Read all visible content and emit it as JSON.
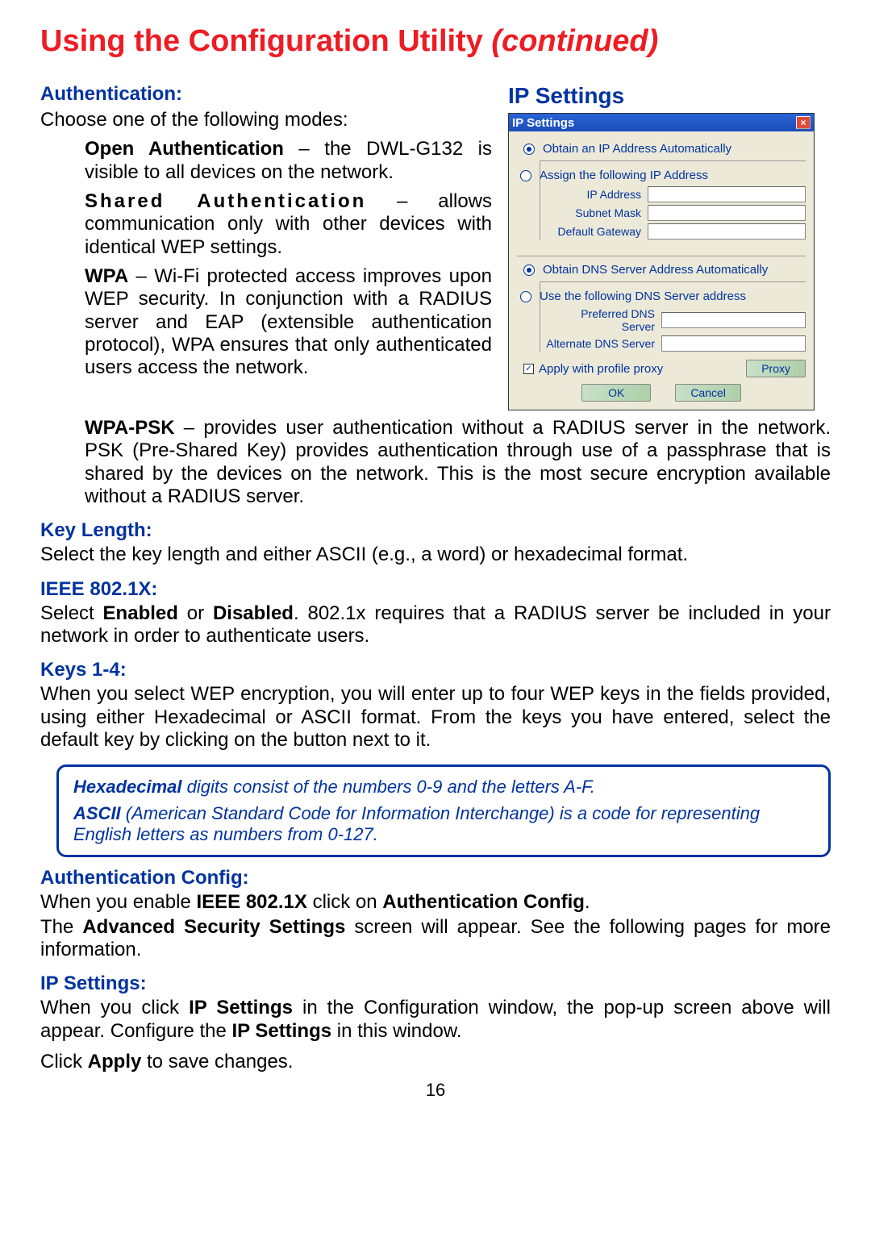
{
  "title_main": "Using the Configuration Utility ",
  "title_cont": "(continued)",
  "auth_header": "Authentication:",
  "auth_intro": "Choose one of the following modes:",
  "open_auth_b": "Open Authentication",
  "open_auth_txt": " – the DWL-G132 is visible to all devices on the network.",
  "shared_b": "Shared Authentication",
  "shared_txt": " – allows communication only with other devices with identical WEP settings.",
  "wpa_b": "WPA",
  "wpa_txt": " – Wi-Fi protected access improves upon WEP security. In conjunction with a RADIUS server and EAP (extensible authentication protocol), WPA ensures that only authenticated users access the network.",
  "wpapsk_b": "WPA-PSK",
  "wpapsk_txt": " –  provides user authentication without a RADIUS server in the network. PSK (Pre-Shared Key) provides authentication through use of a  passphrase that is shared by the devices on the network. This is the most secure encryption available without a RADIUS server.",
  "keylen_h": "Key Length:",
  "keylen_txt": "Select the key length and either ASCII (e.g., a word) or hexadecimal format.",
  "ieee_h": "IEEE 802.1X:",
  "ieee_txt1": "Select ",
  "ieee_b1": "Enabled",
  "ieee_txt2": " or ",
  "ieee_b2": "Disabled",
  "ieee_txt3": ". 802.1x requires that a RADIUS server be included in your network in order to authenticate users.",
  "keys_h": "Keys 1-4:",
  "keys_txt": "When you select WEP encryption, you will enter up to four WEP keys in the fields provided, using either Hexadecimal or ASCII format. From the keys you have entered, select the default key by clicking on the button next to it.",
  "hex_b": "Hexadecimal",
  "hex_txt": " digits consist of the numbers 0-9 and the letters A-F.",
  "ascii_b": "ASCII",
  "ascii_txt": " (American Standard Code for Information Interchange) is a code for representing English letters as numbers from 0-127.",
  "authcfg_h": "Authentication Config:",
  "authcfg_txt1": "When you enable ",
  "authcfg_b1": "IEEE 802.1X",
  "authcfg_txt2": " click on ",
  "authcfg_b2": "Authentication Config",
  "authcfg_txt3": ".",
  "authcfg_txt4a": "The ",
  "authcfg_b3": "Advanced Security Settings",
  "authcfg_txt4b": " screen will appear. See the following pages for more information.",
  "ipset_h": "IP Settings:",
  "ipset_txt1": "When you click ",
  "ipset_b1": "IP Settings",
  "ipset_txt2": " in the Configuration window, the pop-up screen above will appear. Configure the ",
  "ipset_b2": "IP Settings",
  "ipset_txt3": " in this window.",
  "apply_txt1": "Click ",
  "apply_b": "Apply",
  "apply_txt2": " to save changes.",
  "page_num": "16",
  "ip_heading": "IP Settings",
  "dialog": {
    "title": "IP Settings",
    "close": "×",
    "r1": "Obtain an IP Address Automatically",
    "r2": "Assign the following IP Address",
    "f_ip": "IP Address",
    "f_mask": "Subnet Mask",
    "f_gw": "Default Gateway",
    "r3": "Obtain DNS Server Address Automatically",
    "r4": "Use the following DNS Server address",
    "f_pdns": "Preferred DNS Server",
    "f_adns": "Alternate DNS Server",
    "chk": "✓",
    "apply_proxy": "Apply with profile proxy",
    "btn_proxy": "Proxy",
    "btn_ok": "OK",
    "btn_cancel": "Cancel"
  }
}
